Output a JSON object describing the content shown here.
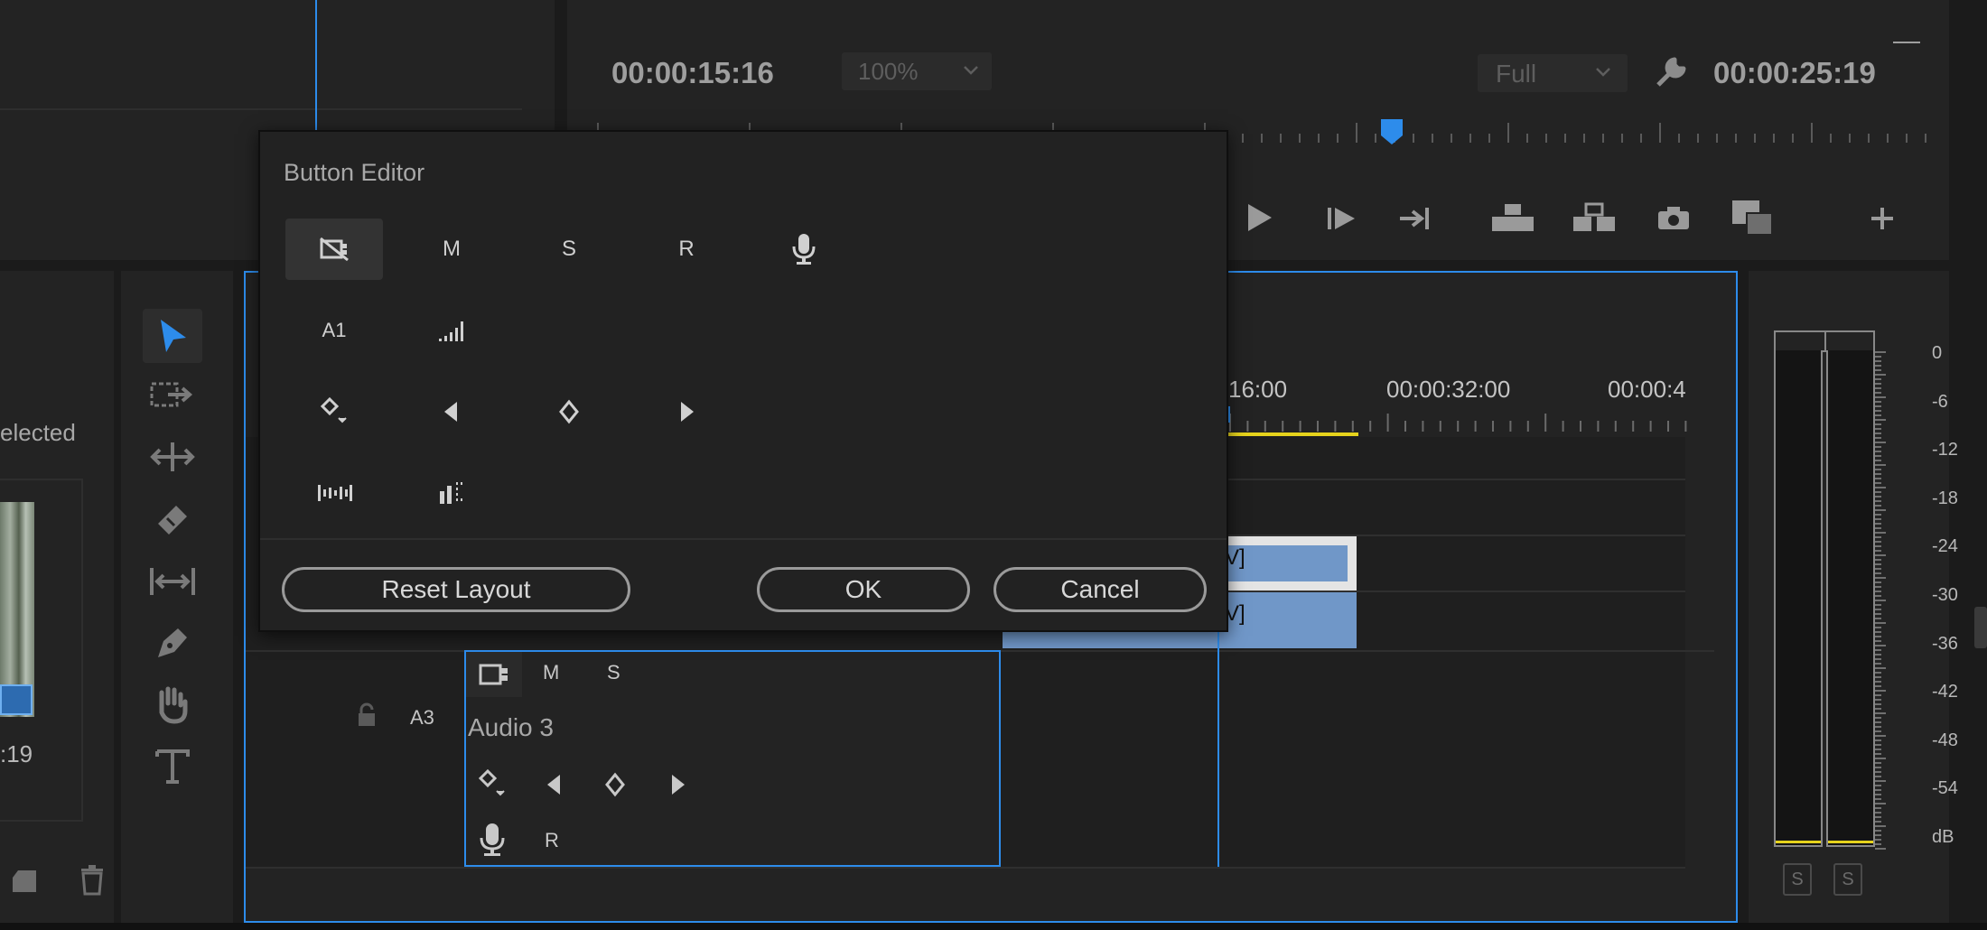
{
  "program_monitor": {
    "timecode_left": "00:00:15:16",
    "zoom": "100%",
    "quality": "Full",
    "timecode_right": "00:00:25:19"
  },
  "project_panel": {
    "selected_text": "elected",
    "thumb_duration": ":19"
  },
  "timeline": {
    "ruler": [
      "16:00",
      "00:00:32:00",
      "00:00:4"
    ],
    "clip_v1_label": "V]",
    "clip_v2_label": "V]",
    "track_a3": {
      "id": "A3",
      "name": "Audio 3",
      "mute": "M",
      "solo": "S",
      "record": "R"
    }
  },
  "audio_meter": {
    "labels": [
      "0",
      "-6",
      "-12",
      "-18",
      "-24",
      "-30",
      "-36",
      "-42",
      "-48",
      "-54",
      "dB"
    ],
    "solo_left": "S",
    "solo_right": "S"
  },
  "button_editor": {
    "title": "Button Editor",
    "icons": {
      "mute": "M",
      "solo": "S",
      "record": "R",
      "track_name": "A1"
    },
    "reset_label": "Reset Layout",
    "ok_label": "OK",
    "cancel_label": "Cancel"
  },
  "colors": {
    "accent_blue": "#2d8ceb",
    "clip_blue": "#7097c8",
    "meter_yellow": "#e6d31c"
  }
}
